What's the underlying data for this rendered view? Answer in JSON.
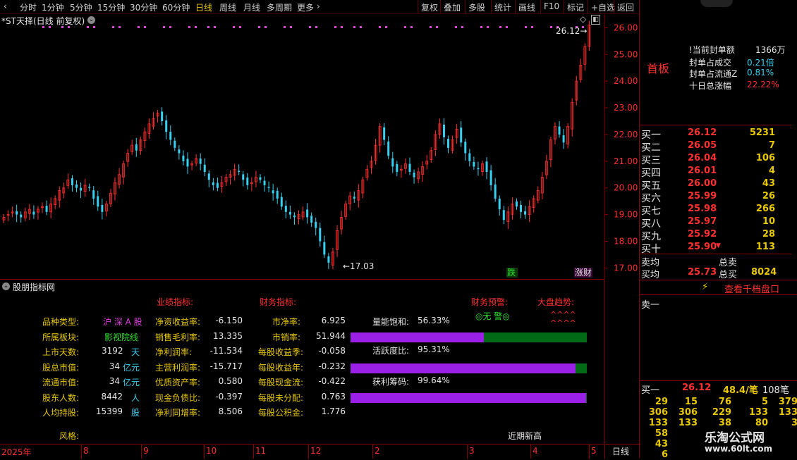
{
  "toolbar": {
    "left_items": [
      "分时",
      "1分钟",
      "5分钟",
      "15分钟",
      "30分钟",
      "60分钟",
      "日线",
      "周线",
      "月线",
      "多周期",
      "更多"
    ],
    "right_items": [
      "复权",
      "叠加",
      "多股",
      "统计",
      "画线",
      "F10",
      "标记",
      "+自选",
      "返回"
    ],
    "active": "日线"
  },
  "chart_header": {
    "title": "*ST天择(日线 前复权)"
  },
  "chart_data": {
    "type": "candlestick",
    "ylim": [
      16.8,
      26.3
    ],
    "yticks": [
      26.0,
      25.0,
      24.0,
      23.0,
      22.0,
      21.0,
      20.0,
      19.0,
      18.0,
      17.0
    ],
    "ytick_labels": [
      "26.00",
      "25.00",
      "24.00",
      "23.00",
      "22.00",
      "21.00",
      "20.00",
      "19.00",
      "18.00",
      "17.00"
    ],
    "x_labels": [
      "2025年",
      "8",
      "9",
      "10",
      "11",
      "12",
      "2",
      "3",
      "4",
      "5"
    ],
    "annotations": {
      "high_label": "26.12",
      "low_label": "17.03",
      "badge_fall": "跌",
      "badge_limit": "涨财"
    },
    "closes": [
      18.9,
      19.0,
      19.1,
      19.0,
      18.9,
      19.1,
      19.2,
      19.0,
      19.2,
      19.3,
      19.1,
      19.4,
      19.6,
      19.9,
      20.0,
      20.3,
      20.1,
      20.0,
      19.9,
      20.1,
      20.0,
      19.6,
      19.3,
      19.1,
      19.4,
      19.8,
      20.2,
      20.5,
      20.9,
      21.3,
      21.6,
      21.4,
      21.8,
      22.1,
      22.4,
      22.6,
      22.8,
      22.5,
      22.1,
      21.8,
      21.5,
      21.3,
      21.0,
      20.8,
      20.9,
      21.1,
      20.9,
      20.6,
      20.3,
      20.1,
      20.0,
      20.2,
      20.4,
      20.5,
      20.7,
      20.6,
      20.3,
      20.1,
      20.2,
      20.4,
      20.3,
      20.1,
      20.0,
      19.8,
      19.6,
      19.3,
      19.1,
      19.0,
      18.9,
      19.0,
      19.1,
      18.9,
      18.7,
      18.5,
      18.0,
      17.5,
      17.2,
      17.6,
      18.4,
      18.9,
      19.4,
      19.7,
      19.6,
      19.9,
      20.3,
      20.7,
      21.0,
      21.6,
      22.3,
      21.8,
      21.2,
      20.8,
      20.6,
      20.7,
      20.9,
      20.6,
      20.4,
      20.6,
      20.8,
      21.0,
      21.4,
      22.0,
      22.4,
      21.9,
      21.5,
      21.8,
      22.2,
      21.7,
      21.3,
      21.0,
      20.8,
      20.7,
      20.9,
      20.6,
      20.1,
      19.6,
      19.2,
      18.8,
      19.1,
      19.4,
      19.3,
      19.1,
      19.0,
      19.3,
      19.6,
      19.9,
      20.4,
      21.0,
      21.8,
      22.3,
      22.0,
      21.7,
      22.3,
      23.2,
      24.0,
      24.6,
      25.3,
      26.1
    ],
    "highlights": {
      "volume_price_saturation": "56.33%",
      "activity": "95.31%",
      "profit_chips": "99.64%"
    }
  },
  "indicator": {
    "title": "股朋指标网",
    "section_perf": "业绩指标:",
    "section_fin": "财务指标:",
    "section_warn": "财务预警:",
    "section_trend": "大盘趋势:",
    "warn_value": "◎无 警◎",
    "trend_value_1": "^^^^",
    "trend_value_2": "^^^^",
    "left_rows": [
      {
        "label": "品种类型:",
        "value": "沪 深 A 股",
        "unit": ""
      },
      {
        "label": "所属板块:",
        "value": "影视院线",
        "unit": ""
      },
      {
        "label": "上市天数:",
        "value": "3192",
        "unit": "天"
      },
      {
        "label": "股总市值:",
        "value": "34",
        "unit": "亿元"
      },
      {
        "label": "流通市值:",
        "value": "34",
        "unit": "亿元"
      },
      {
        "label": "股东人数:",
        "value": "8442",
        "unit": "人"
      },
      {
        "label": "人均持股:",
        "value": "15399",
        "unit": "股"
      }
    ],
    "mid_rows": [
      {
        "label": "净资收益率:",
        "value": "-6.150"
      },
      {
        "label": "销售毛利率:",
        "value": "13.335"
      },
      {
        "label": "净利润率:",
        "value": "-11.534"
      },
      {
        "label": "主营利润率:",
        "value": "-15.717"
      },
      {
        "label": "优质资产率:",
        "value": "0.580"
      },
      {
        "label": "现金负债比:",
        "value": "-0.397"
      },
      {
        "label": "净利同增率:",
        "value": "8.506"
      }
    ],
    "fin_rows": [
      {
        "label": "市净率:",
        "value": "6.925"
      },
      {
        "label": "市销率:",
        "value": "51.944"
      },
      {
        "label": "每股收益季:",
        "value": "-0.058"
      },
      {
        "label": "每股收益年:",
        "value": "-0.232"
      },
      {
        "label": "每股现金流:",
        "value": "-0.422"
      },
      {
        "label": "每股未分配:",
        "value": "0.763"
      },
      {
        "label": "每股公积金:",
        "value": "1.776"
      }
    ],
    "bars": [
      {
        "label": "量能饱和:",
        "value": "56.33%",
        "fill": 0.5633
      },
      {
        "label": "活跃度比:",
        "value": "95.31%",
        "fill": 0.9531
      },
      {
        "label": "获利筹码:",
        "value": "99.64%",
        "fill": 0.9964
      }
    ],
    "style_label": "风格:",
    "recent_label": "近期新高"
  },
  "right": {
    "tag": "首板",
    "stats": [
      {
        "label": "!当前封单额",
        "value": "1366万"
      },
      {
        "label": "封单占成交",
        "value": "0.21倍"
      },
      {
        "label": "封单占流通Z",
        "value": "0.81%"
      },
      {
        "label": "十日总涨幅",
        "value": "22.22%"
      }
    ],
    "bids": [
      {
        "label": "买一",
        "price": "26.12",
        "vol": "5231"
      },
      {
        "label": "买二",
        "price": "26.05",
        "vol": "7"
      },
      {
        "label": "买三",
        "price": "26.04",
        "vol": "106"
      },
      {
        "label": "买四",
        "price": "26.01",
        "vol": "4"
      },
      {
        "label": "买五",
        "price": "26.00",
        "vol": "43"
      },
      {
        "label": "买六",
        "price": "25.99",
        "vol": "26"
      },
      {
        "label": "买七",
        "price": "25.98",
        "vol": "266"
      },
      {
        "label": "买八",
        "price": "25.97",
        "vol": "10"
      },
      {
        "label": "买九",
        "price": "25.92",
        "vol": "28"
      },
      {
        "label": "买十",
        "price": "25.90",
        "vol": "113"
      }
    ],
    "avg_sell": "卖均",
    "total_sell": "总卖",
    "avg_buy": "买均",
    "avg_buy_value": "25.73",
    "total_buy": "总买",
    "total_buy_value": "8024",
    "view_button": "查看千档盘口",
    "sell_one": "卖一",
    "buy_one_label": "买一",
    "buy_one_price": "26.12",
    "buy_one_avg": "48.4/笔",
    "buy_one_count": "108笔",
    "queue": [
      [
        "29",
        "15",
        "76",
        "5",
        "379"
      ],
      [
        "306",
        "306",
        "229",
        "133",
        "133"
      ],
      [
        "133",
        "133",
        "38",
        "80",
        "3"
      ],
      [
        "58",
        "",
        "",
        "",
        ""
      ],
      [
        "43",
        "",
        "",
        "",
        ""
      ],
      [
        "6",
        "",
        "",
        "",
        ""
      ]
    ],
    "period": "日线"
  },
  "watermark": {
    "title": "乐淘公式网",
    "url": "www.60lt.com"
  }
}
